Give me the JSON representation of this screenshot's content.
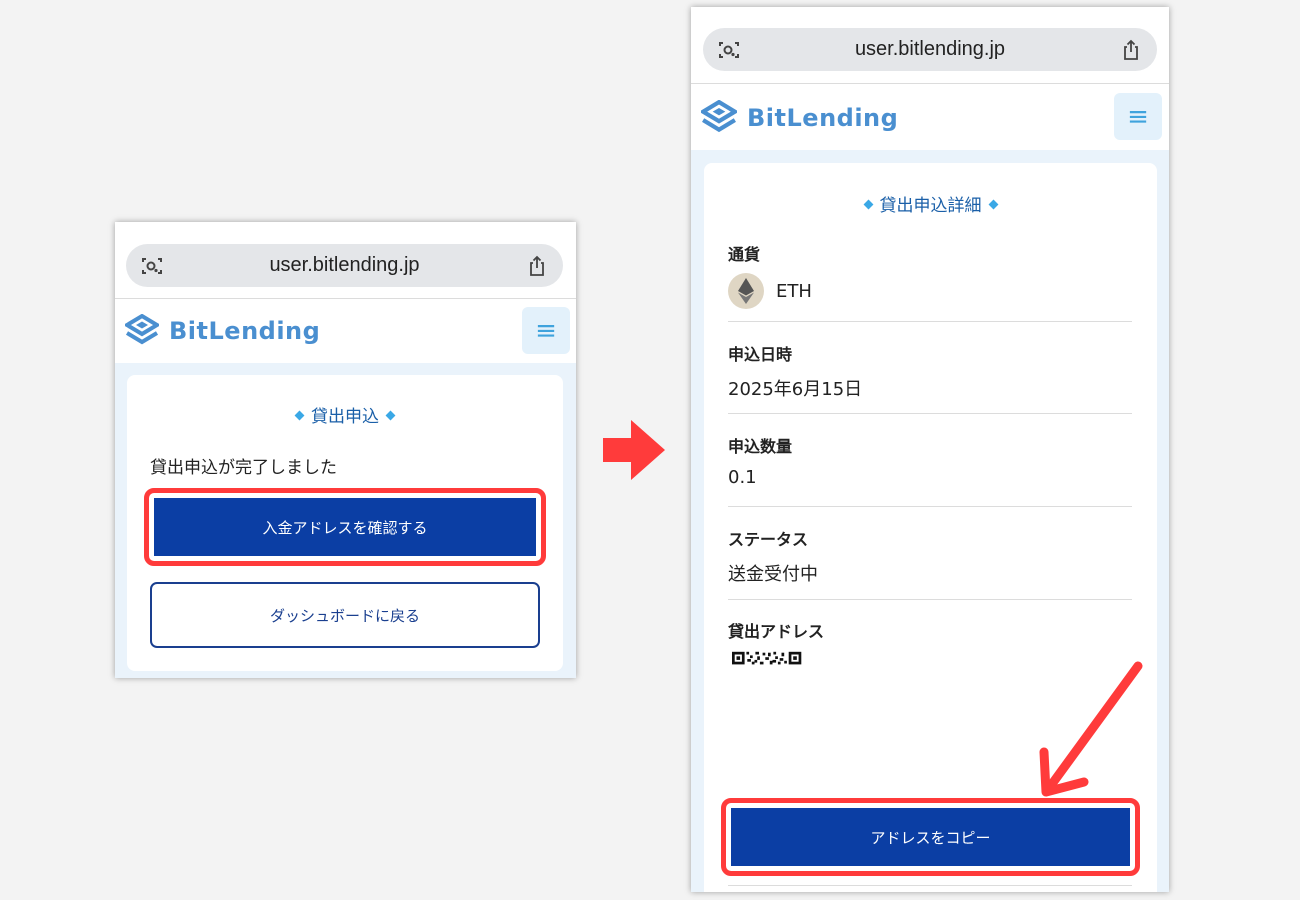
{
  "left_screen": {
    "url": "user.bitlending.jp",
    "brand": "BitLending",
    "menu_icon": "≡",
    "card_title": "貸出申込",
    "completion_message": "貸出申込が完了しました",
    "primary_button": "入金アドレスを確認する",
    "secondary_button": "ダッシュボードに戻る"
  },
  "right_screen": {
    "url": "user.bitlending.jp",
    "brand": "BitLending",
    "menu_icon": "≡",
    "card_title": "貸出申込詳細",
    "fields": [
      {
        "label": "通貨",
        "value": "ETH"
      },
      {
        "label": "申込日時",
        "value": "2025年6月15日"
      },
      {
        "label": "申込数量",
        "value": "0.1"
      },
      {
        "label": "ステータス",
        "value": "送金受付中"
      },
      {
        "label": "貸出アドレス",
        "value": ""
      }
    ],
    "copy_button": "アドレスをコピー"
  },
  "icons": {
    "url_left": "camera-lens-icon",
    "url_right": "share-icon",
    "brand_logo": "bitlending-logo-icon",
    "coin": "ethereum-icon",
    "flow_arrow": "arrow-right-icon",
    "pointer_arrow": "arrow-down-left-icon"
  },
  "colors": {
    "primary_button": "#0b3ea4",
    "highlight": "#ff3b3b",
    "brand": "#4a8fd0",
    "title": "#1a5fa8"
  }
}
